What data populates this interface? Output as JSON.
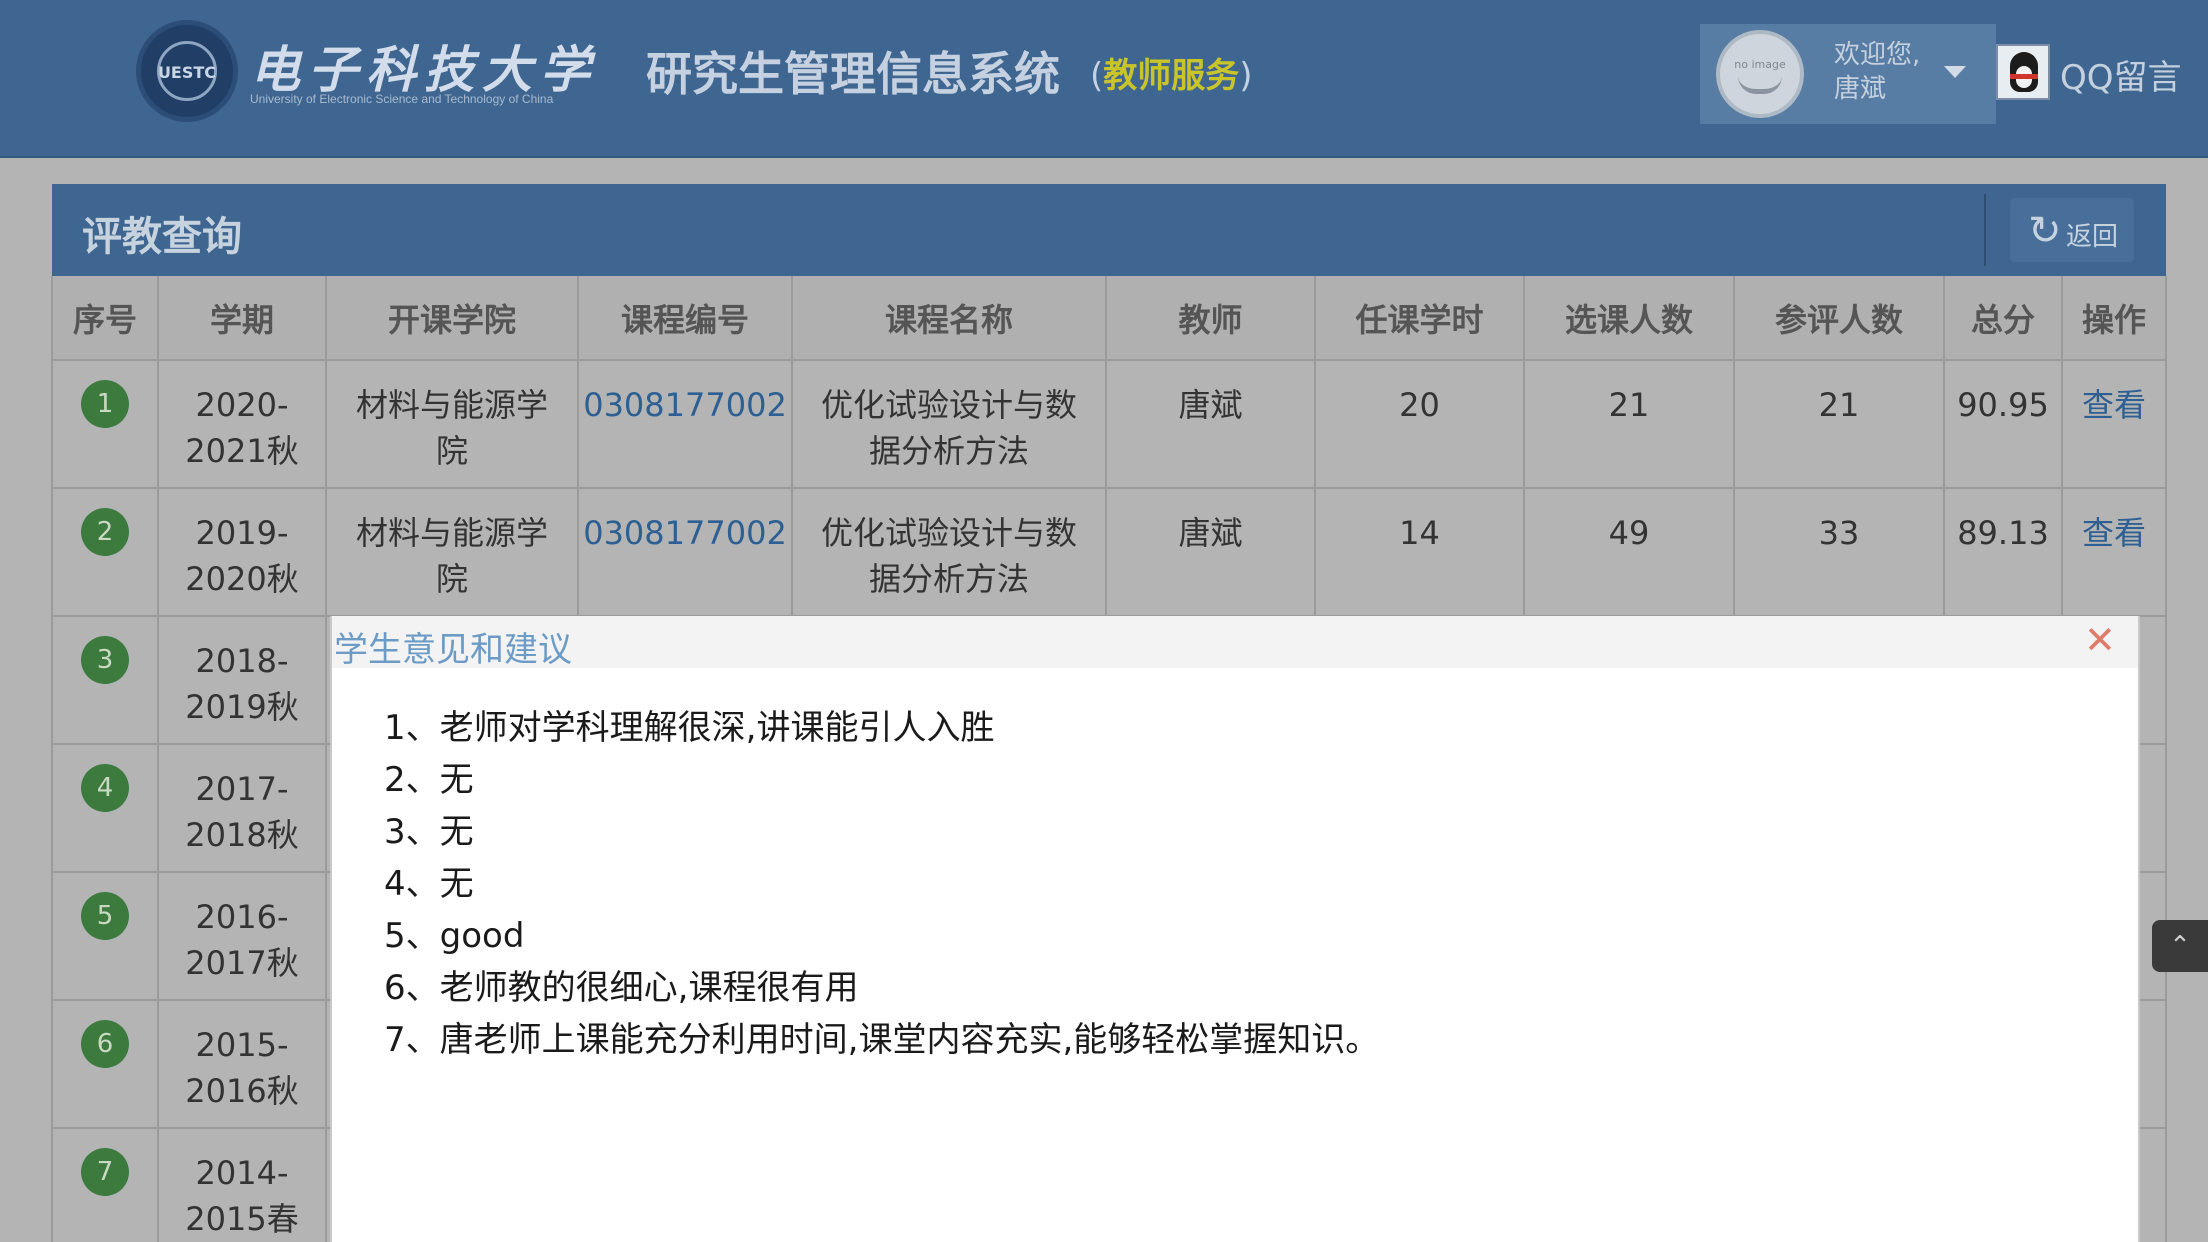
{
  "header": {
    "logo_cn": "电子科技大学",
    "logo_en": "University of Electronic Science and Technology of China",
    "logo_seal_text": "UESTC",
    "system_title": "研究生管理信息系统",
    "system_subtitle_prefix": "(",
    "system_subtitle": "教师服务",
    "system_subtitle_suffix": ")",
    "avatar_text": "no image",
    "welcome": "欢迎您,",
    "user_name": "唐斌",
    "qq_label": "QQ留言"
  },
  "panel": {
    "title": "评教查询",
    "back_label": "返回",
    "back_icon": "refresh-icon"
  },
  "table": {
    "headers": [
      "序号",
      "学期",
      "开课学院",
      "课程编号",
      "课程名称",
      "教师",
      "任课学时",
      "选课人数",
      "参评人数",
      "总分",
      "操作"
    ],
    "rows": [
      {
        "no": "1",
        "term": "2020-\n2021秋",
        "college": "材料与能源学\n院",
        "code": "0308177002",
        "course": "优化试验设计与数\n据分析方法",
        "teacher": "唐斌",
        "hours": "20",
        "enrolled": "21",
        "evaluated": "21",
        "score": "90.95",
        "action": "查看"
      },
      {
        "no": "2",
        "term": "2019-\n2020秋",
        "college": "材料与能源学\n院",
        "code": "0308177002",
        "course": "优化试验设计与数\n据分析方法",
        "teacher": "唐斌",
        "hours": "14",
        "enrolled": "49",
        "evaluated": "33",
        "score": "89.13",
        "action": "查看"
      },
      {
        "no": "3",
        "term": "2018-\n2019秋"
      },
      {
        "no": "4",
        "term": "2017-\n2018秋"
      },
      {
        "no": "5",
        "term": "2016-\n2017秋"
      },
      {
        "no": "6",
        "term": "2015-\n2016秋"
      },
      {
        "no": "7",
        "term": "2014-\n2015春"
      }
    ]
  },
  "modal": {
    "title": "学生意见和建议",
    "close_icon": "close-icon",
    "comments": [
      "1、老师对学科理解很深,讲课能引人入胜",
      "2、无",
      "3、无",
      "4、无",
      "5、good",
      "6、老师教的很细心,课程很有用",
      "7、唐老师上课能充分利用时间,课堂内容充实,能够轻松掌握知识。"
    ]
  },
  "scroll_top_icon": "chevron-double-up-icon",
  "colors": {
    "header_bg": "#3f6690",
    "accent_yellow": "#c9c429",
    "link_blue": "#2d5f92",
    "badge_green": "#3c7a3e",
    "overlay_gray": "#b4b4b4",
    "modal_title": "#6c9bc6",
    "close_red": "#e07b6b"
  }
}
